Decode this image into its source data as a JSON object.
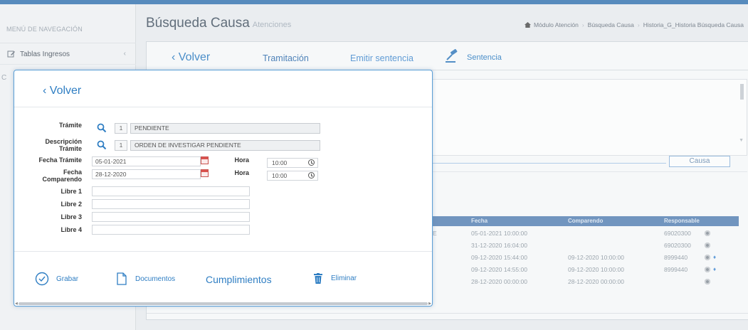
{
  "sidebar": {
    "header": "MENÚ DE NAVEGACIÓN",
    "items": [
      {
        "label": "Tablas Ingresos",
        "icon": "edit-icon"
      }
    ],
    "fragment": "C"
  },
  "main": {
    "title": "Búsqueda Causa",
    "subtitle": "Atenciones",
    "breadcrumb": [
      "Módulo Atención",
      "Búsqueda Causa",
      "Historia_G_Historia Búsqueda Causa"
    ],
    "tabs": {
      "back": "Volver",
      "tramitacion": "Tramitación",
      "emitir": "Emitir sentencia",
      "sentencia": "Sentencia"
    },
    "causa_button": "Causa",
    "table": {
      "headers": [
        "Fecha",
        "Comparendo",
        "Responsable"
      ],
      "rows": [
        {
          "prefix": "E",
          "fecha": "05-01-2021 10:00:00",
          "comparendo": "",
          "responsable": "69020300",
          "icons": [
            "gear-icon"
          ]
        },
        {
          "prefix": "",
          "fecha": "31-12-2020 16:04:00",
          "comparendo": "",
          "responsable": "69020300",
          "icons": [
            "gear-icon"
          ]
        },
        {
          "prefix": "",
          "fecha": "09-12-2020 15:44:00",
          "comparendo": "09-12-2020 10:00:00",
          "responsable": "8999440",
          "icons": [
            "gear-icon",
            "pin-icon"
          ]
        },
        {
          "prefix": "",
          "fecha": "09-12-2020 14:55:00",
          "comparendo": "09-12-2020 10:00:00",
          "responsable": "8999440",
          "icons": [
            "gear-icon",
            "pin-icon"
          ]
        },
        {
          "prefix": "",
          "fecha": "28-12-2020 00:00:00",
          "comparendo": "28-12-2020 00:00:00",
          "responsable": "",
          "icons": [
            "gear-icon"
          ]
        }
      ]
    }
  },
  "modal": {
    "back": "Volver",
    "tramite": {
      "label": "Trámite",
      "code": "1",
      "value": "PENDIENTE"
    },
    "descripcion": {
      "label_line1": "Descripción",
      "label_line2": "Trámite",
      "code": "1",
      "value": "ORDEN DE INVESTIGAR PENDIENTE"
    },
    "fecha_tramite": {
      "label": "Fecha Trámite",
      "value": "05-01-2021",
      "hora_label": "Hora",
      "hora": "10:00"
    },
    "fecha_comparendo": {
      "label_line1": "Fecha",
      "label_line2": "Comparendo",
      "value": "28-12-2020",
      "hora_label": "Hora",
      "hora": "10:00"
    },
    "libres": [
      {
        "label": "Libre 1",
        "value": ""
      },
      {
        "label": "Libre 2",
        "value": ""
      },
      {
        "label": "Libre 3",
        "value": ""
      },
      {
        "label": "Libre 4",
        "value": ""
      }
    ],
    "buttons": {
      "grabar": "Grabar",
      "documentos": "Documentos",
      "cumplimientos": "Cumplimientos",
      "eliminar": "Eliminar"
    }
  },
  "colors": {
    "accent": "#2f7ec3",
    "table_header": "#5d86b8",
    "topbar": "#3f7bb6",
    "calendar": "#d9534f"
  }
}
